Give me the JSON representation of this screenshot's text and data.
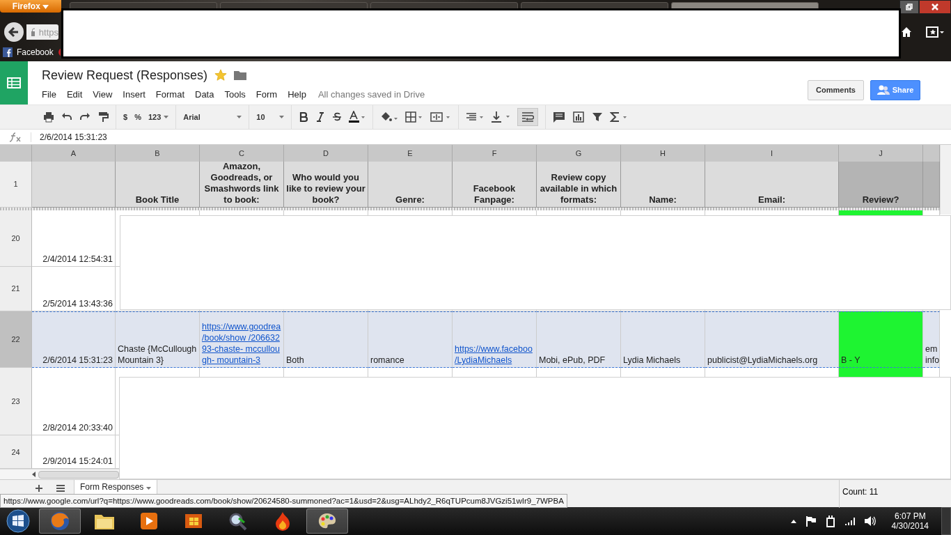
{
  "browser": {
    "menu_button": "Firefox",
    "tabs": [
      {
        "selected": false
      },
      {
        "selected": false
      },
      {
        "selected": false
      },
      {
        "selected": false
      },
      {
        "selected": true
      }
    ],
    "url_prefix": "https",
    "bookmarks": [
      {
        "label": "Facebook"
      }
    ]
  },
  "document": {
    "title": "Review Request (Responses)",
    "starred": true,
    "menu": [
      "File",
      "Edit",
      "View",
      "Insert",
      "Format",
      "Data",
      "Tools",
      "Form",
      "Help"
    ],
    "save_status": "All changes saved in Drive",
    "comments_button": "Comments",
    "share_button": "Share"
  },
  "toolbar": {
    "currency": "$",
    "percent": "%",
    "number_format": "123",
    "font": "Arial",
    "font_size": "10",
    "wrap_selected": true
  },
  "formula_bar": {
    "value": "2/6/2014 15:31:23"
  },
  "columns": [
    "A",
    "B",
    "C",
    "D",
    "E",
    "F",
    "G",
    "H",
    "I",
    "J"
  ],
  "header_row": {
    "number": "1",
    "cells": [
      null,
      "Book Title",
      "Amazon, Goodreads, or Smashwords link to book:",
      "Who would you like to review your book?",
      "Genre:",
      "Facebook Fanpage:",
      "Review copy available in which formats:",
      "Name:",
      "Email:",
      "Review?"
    ]
  },
  "rows": [
    {
      "number": "20",
      "selected": false,
      "cells": [
        {
          "kind": "date",
          "text": "2/4/2014 12:54:31"
        },
        null,
        null,
        null,
        null,
        null,
        null,
        null,
        null,
        {
          "color": "#1ef431"
        },
        null
      ]
    },
    {
      "number": "21",
      "selected": false,
      "cells": [
        {
          "kind": "date",
          "text": "2/5/2014 13:43:36"
        },
        null,
        null,
        null,
        null,
        null,
        null,
        null,
        null,
        null,
        null
      ]
    },
    {
      "number": "22",
      "selected": true,
      "cells": [
        {
          "kind": "date",
          "text": "2/6/2014 15:31:23"
        },
        {
          "kind": "text",
          "text": "Chaste {McCullough Mountain 3}"
        },
        {
          "kind": "link",
          "text": "https://www.goodrea /book/show /20663293-chaste- mccullough- mountain-3"
        },
        {
          "kind": "text",
          "text": "Both"
        },
        {
          "kind": "text",
          "text": "romance"
        },
        {
          "kind": "link",
          "text": "https://www.faceboo /LydiaMichaels"
        },
        {
          "kind": "text",
          "text": "Mobi, ePub, PDF"
        },
        {
          "kind": "text",
          "text": "Lydia Michaels"
        },
        {
          "kind": "text",
          "text": "publicist@LydiaMichaels.org"
        },
        {
          "kind": "text",
          "text": "B - Y",
          "color": "#1ef431"
        },
        {
          "kind": "text",
          "text": "em info"
        }
      ]
    },
    {
      "number": "23",
      "selected": false,
      "cells": [
        {
          "kind": "date",
          "text": "2/8/2014 20:33:40"
        },
        null,
        null,
        null,
        null,
        null,
        null,
        null,
        null,
        {
          "color": "#1ef431"
        },
        null
      ]
    },
    {
      "number": "24",
      "selected": false,
      "cells": [
        {
          "kind": "date",
          "text": "2/9/2014 15:24:01"
        },
        null,
        null,
        null,
        null,
        null,
        null,
        null,
        null,
        null,
        null
      ]
    }
  ],
  "sheet_tabs": [
    {
      "label": "Form Responses",
      "selected": true
    }
  ],
  "link_preview": "https://www.google.com/url?q=https://www.goodreads.com/book/show/20624580-summoned?ac=1&usd=2&usg=ALhdy2_R6qTUPcum8JVGzi51wIr9_7WPBA",
  "status": "Count: 11",
  "taskbar": {
    "time": "6:07 PM",
    "date": "4/30/2014"
  }
}
